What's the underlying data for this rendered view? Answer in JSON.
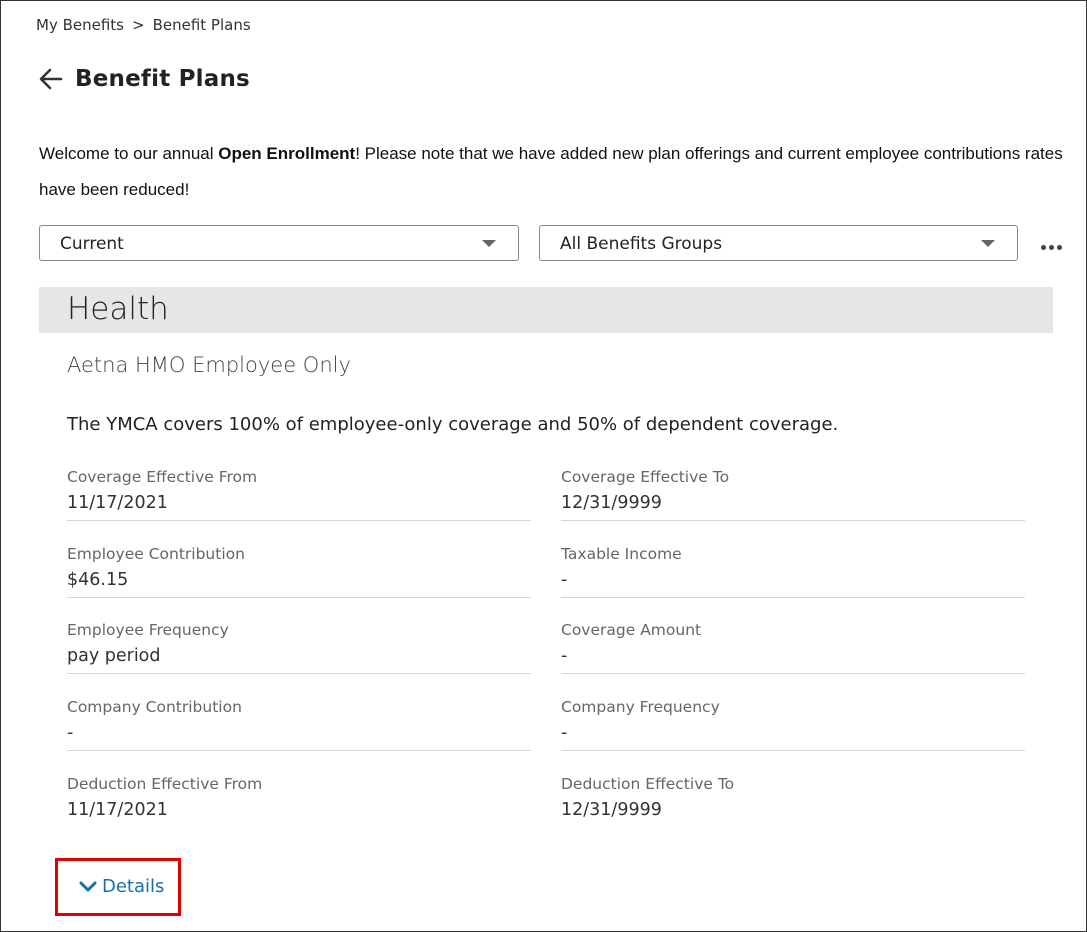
{
  "breadcrumb": {
    "items": [
      "My Benefits",
      "Benefit Plans"
    ],
    "separator": ">"
  },
  "page": {
    "title": "Benefit Plans"
  },
  "welcome": {
    "prefix": "Welcome to our annual ",
    "highlight": "Open Enrollment",
    "suffix": "! Please note that we have added new plan offerings and current employee contributions rates have been reduced!"
  },
  "filters": {
    "period": {
      "value": "Current"
    },
    "group": {
      "value": "All Benefits Groups"
    }
  },
  "section": {
    "title": "Health"
  },
  "plan": {
    "name": "Aetna HMO Employee Only",
    "description": "The YMCA covers 100% of employee-only coverage and 50% of dependent coverage."
  },
  "fields": {
    "coverage_from": {
      "label": "Coverage Effective From",
      "value": "11/17/2021"
    },
    "coverage_to": {
      "label": "Coverage Effective To",
      "value": "12/31/9999"
    },
    "employee_contribution": {
      "label": "Employee Contribution",
      "value": "$46.15"
    },
    "taxable_income": {
      "label": "Taxable Income",
      "value": "-"
    },
    "employee_frequency": {
      "label": "Employee Frequency",
      "value": "pay period"
    },
    "coverage_amount": {
      "label": "Coverage Amount",
      "value": "-"
    },
    "company_contribution": {
      "label": "Company Contribution",
      "value": "-"
    },
    "company_frequency": {
      "label": "Company Frequency",
      "value": "-"
    },
    "deduction_from": {
      "label": "Deduction Effective From",
      "value": "11/17/2021"
    },
    "deduction_to": {
      "label": "Deduction Effective To",
      "value": "12/31/9999"
    }
  },
  "details": {
    "label": "Details"
  },
  "colors": {
    "accent": "#1a6fa8",
    "highlight_border": "#e00000",
    "section_bg": "#e6e6e6"
  }
}
